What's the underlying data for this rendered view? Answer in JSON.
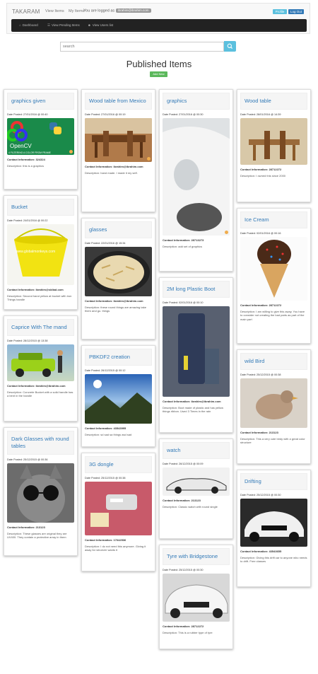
{
  "nav": {
    "brand": "TAKARAM",
    "links": [
      "View Items",
      "My Items"
    ],
    "logged_in": "You are logged as",
    "email": "ibrahim@ibrahim.com",
    "profile": "Profile",
    "logout": "Log Out"
  },
  "subnav": [
    "Dashboard",
    "View Pending Items",
    "View Users list"
  ],
  "search": {
    "placeholder": "search"
  },
  "page": {
    "heading": "Published Items",
    "add_new": "Add New"
  },
  "cards": {
    "c1": {
      "title": "graphics given",
      "posted": "Date Posted: 27/01/2016 @ 00:40",
      "contact": "Contact Information: 324324",
      "desc": "Description: this is a graphics"
    },
    "c2": {
      "title": "Bucket",
      "posted": "Date Posted: 24/01/2016 @ 00:22",
      "contact": "Contact Information: ibrahim@sidiad.com",
      "desc": "Description: Second hand yellow at bucket with iron Things handle"
    },
    "c3": {
      "title": "Caprice With The mand",
      "posted": "Date Posted: 28/12/2015 @ 13:38",
      "contact": "Contact Information: ibrahim@ibrahim.com",
      "desc": "Description: Concrete Bucket with a solid handle has a bent in the handle"
    },
    "c4": {
      "title": "Dark Glasses with round tables",
      "posted": "Date Posted: 25/12/2015 @ 00:36",
      "contact": "Contact Information: 213123",
      "desc": "Description: These glasses are original they are UV400. They contain a protective array in them"
    },
    "c5": {
      "title": "Wood table from Mexico",
      "posted": "Date Posted: 27/01/2016 @ 00:19",
      "contact": "Contact Information: ibrahim@ibrahim.com",
      "desc": "Description: hand made. I made it my self."
    },
    "c6": {
      "title": "glasses",
      "posted": "Date Posted: 22/01/2016 @ 15:34",
      "contact": "Contact Information: ibrahim@ibrahim.com",
      "desc": "Description: these round things are amazing take them and go. things"
    },
    "c7": {
      "title": "PBKDF2 creation",
      "posted": "Date Posted: 26/12/2015 @ 00:12",
      "contact": "Contact Information: 43543995",
      "desc": "Description: sd sad sa things asd sad"
    },
    "c8": {
      "title": "3G dongle",
      "posted": "Date Posted: 25/12/2015 @ 00:38",
      "contact": "Contact Information: 17642536",
      "desc": "Description: I do not need this anymore. Giving it away for whoever wants it"
    },
    "c9": {
      "title": "graphics",
      "posted": "Date Posted: 27/01/2016 @ 00:30",
      "contact": "Contact Information: 28713273",
      "desc": "Description: add set of graphics"
    },
    "c10": {
      "title": "2M long Plastic Boot",
      "posted": "Date Posted: 02/01/2016 @ 00:10",
      "contact": "Contact Information: ibrahim@ibrahim.com",
      "desc": "Description: Boot made of plastic and has yellow things ribbon. Used 3 Times in the rain"
    },
    "c11": {
      "title": "watch",
      "posted": "Date Posted: 26/12/2015 @ 00:09",
      "contact": "Contact Information: 213123",
      "desc": "Description: Classic watch with round single"
    },
    "c12": {
      "title": "Tyre with Bridgestone",
      "posted": "Date Posted: 25/12/2015 @ 00:30",
      "contact": "Contact Information: 28712272",
      "desc": "Description: This is a rubber type of tyre"
    },
    "c13": {
      "title": "Wood table",
      "posted": "Date Posted: 28/01/2016 @ 14:39",
      "contact": "Contact Information: 28712272",
      "desc": "Description: I owned this since 2000"
    },
    "c14": {
      "title": "Ice Cream",
      "posted": "Date Posted: 02/01/2016 @ 00:16",
      "contact": "Contact Information: 28712272",
      "desc": "Description: I am willing to give this away. You have to consider not creating the bad parts as part of the main part"
    },
    "c15": {
      "title": "wild Bird",
      "posted": "Date Posted: 25/12/2015 @ 00:38",
      "contact": "Contact Information: 213123",
      "desc": "Description: This a very cute birdy with a great color structure"
    },
    "c16": {
      "title": "Drifting",
      "posted": "Date Posted: 25/12/2015 @ 00:30",
      "contact": "Contact Information: 43543655",
      "desc": "Description: Giving this drift car to anyone who needs to drift. Free classes"
    }
  },
  "thumb_texts": {
    "opencv": "OpenCV",
    "filtering": "4 FILTERING A COLOR FROM FRAME",
    "watermark": "www.globalmonkeys.com"
  },
  "colors": {
    "link": "#337ab7",
    "navbar": "#222222",
    "success": "#5cb85c",
    "info": "#5bc0de",
    "primary": "#337ab7"
  }
}
